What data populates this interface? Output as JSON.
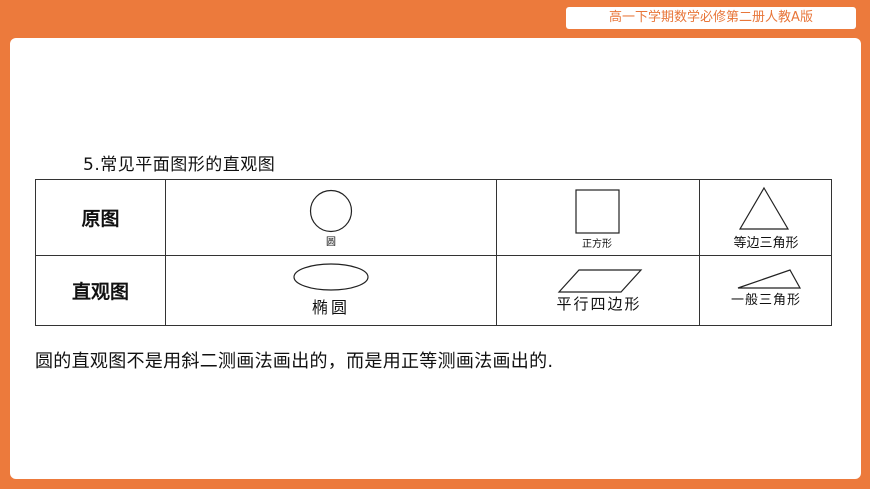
{
  "header": {
    "badge_text": "高一下学期数学必修第二册人教A版"
  },
  "section": {
    "heading": "5.常见平面图形的直观图"
  },
  "table": {
    "row_labels": [
      "原图",
      "直观图"
    ],
    "original": [
      "圆",
      "正方形",
      "等边三角形"
    ],
    "intuitive": [
      "椭圆",
      "平行四边形",
      "一般三角形"
    ]
  },
  "note": "圆的直观图不是用斜二测画法画出的，而是用正等测画法画出的.",
  "colors": {
    "background": "#ec7a3c",
    "panel": "#ffffff",
    "badge_text": "#e8763a"
  }
}
